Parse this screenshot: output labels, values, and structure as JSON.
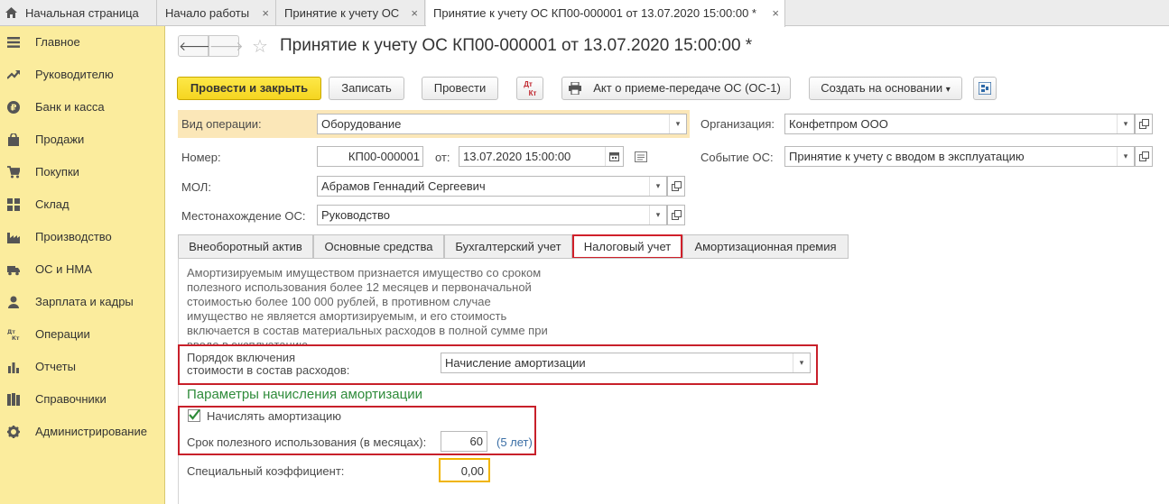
{
  "top_tabs": [
    {
      "label": "Начальная страница"
    },
    {
      "label": "Начало работы",
      "close": "×"
    },
    {
      "label": "Принятие к учету ОС",
      "close": "×"
    },
    {
      "label": "Принятие к учету ОС КП00-000001 от 13.07.2020 15:00:00 *",
      "close": "×"
    }
  ],
  "sidebar": {
    "items": [
      {
        "label": "Главное",
        "icon": "menu-icon"
      },
      {
        "label": "Руководителю",
        "icon": "trend-icon"
      },
      {
        "label": "Банк и касса",
        "icon": "ruble-icon"
      },
      {
        "label": "Продажи",
        "icon": "bag-icon"
      },
      {
        "label": "Покупки",
        "icon": "cart-icon"
      },
      {
        "label": "Склад",
        "icon": "warehouse-icon"
      },
      {
        "label": "Производство",
        "icon": "factory-icon"
      },
      {
        "label": "ОС и НМА",
        "icon": "truck-icon"
      },
      {
        "label": "Зарплата и кадры",
        "icon": "person-icon"
      },
      {
        "label": "Операции",
        "icon": "dt-kt-icon"
      },
      {
        "label": "Отчеты",
        "icon": "bar-chart-icon"
      },
      {
        "label": "Справочники",
        "icon": "books-icon"
      },
      {
        "label": "Администрирование",
        "icon": "gear-icon"
      }
    ]
  },
  "header": {
    "title": "Принятие к учету ОС КП00-000001 от 13.07.2020 15:00:00 *",
    "back": "🡐",
    "forward": "🡒",
    "star": "☆"
  },
  "toolbar": {
    "post_close": "Провести и закрыть",
    "save": "Записать",
    "post": "Провести",
    "dtkt_top": "Дт",
    "dtkt_bottom": "Кт",
    "act": "Акт о приеме-передаче ОС (ОС-1)",
    "create_based": "Создать на основании",
    "create_based_arrow": "▾"
  },
  "form": {
    "operation_label": "Вид операции:",
    "operation_value": "Оборудование",
    "number_label": "Номер:",
    "number_value": "КП00-000001",
    "from_label": "от:",
    "date_value": "13.07.2020 15:00:00",
    "mol_label": "МОЛ:",
    "mol_value": "Абрамов Геннадий Сергеевич",
    "location_label": "Местонахождение ОС:",
    "location_value": "Руководство",
    "org_label": "Организация:",
    "org_value": "Конфетпром ООО",
    "event_label": "Событие ОС:",
    "event_value": "Принятие к учету с вводом в эксплуатацию",
    "dropdown_arrow": "▾"
  },
  "tabs": [
    {
      "label": "Внеоборотный актив"
    },
    {
      "label": "Основные средства"
    },
    {
      "label": "Бухгалтерский учет"
    },
    {
      "label": "Налоговый учет"
    },
    {
      "label": "Амортизационная премия"
    }
  ],
  "tax": {
    "note": "Амортизируемым имуществом признается имущество со сроком полезного использования более 12 месяцев и первоначальной стоимостью более 100 000 рублей, в противном случае имущество не является амортизируемым, и его стоимость включается в состав материальных расходов в полной сумме при вводе в эксплуатацию",
    "order_label_1": "Порядок включения",
    "order_label_2": "стоимости в состав расходов:",
    "order_value": "Начисление амортизации",
    "section_title": "Параметры начисления амортизации",
    "accrue_label": "Начислять амортизацию",
    "accrue_checked": true,
    "term_label": "Срок полезного использования (в месяцах):",
    "term_value": "60",
    "term_years": "(5 лет)",
    "coef_label": "Специальный коэффициент:",
    "coef_value": "0,00"
  },
  "colors": {
    "sidebar_bg": "#fbec9d",
    "primary_button": "#f5d520",
    "highlight_red": "#c8202a",
    "section_green": "#2e8b3a",
    "link_blue": "#3a6ea5",
    "focus_orange": "#f0b400"
  }
}
